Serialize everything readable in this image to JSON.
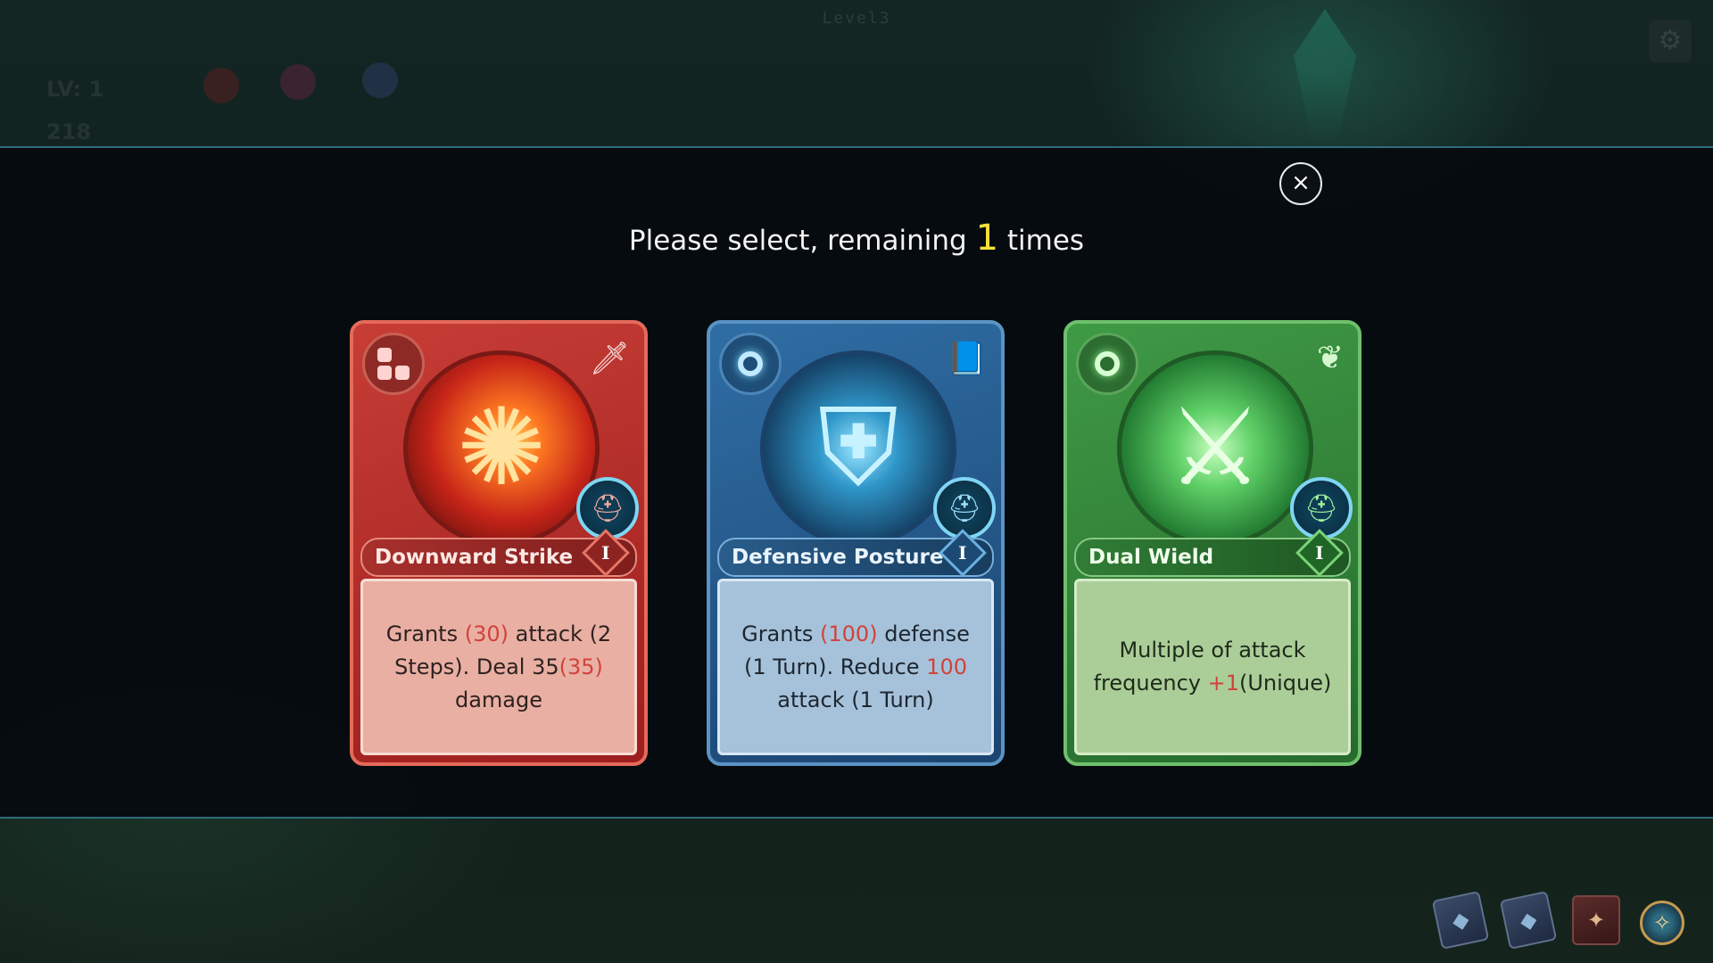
{
  "background": {
    "level_label": "Level3",
    "hud": {
      "level_text": "LV: 1",
      "hp_value": "218"
    }
  },
  "modal": {
    "close_icon": "×",
    "prompt_prefix": "Please select, remaining",
    "remaining_count": "1",
    "prompt_suffix": "times"
  },
  "cards": [
    {
      "name": "Downward Strike",
      "rank": "I",
      "theme": "red",
      "type_icon": "sword-icon",
      "badge_icon": "dots-icon",
      "art_icon": "slash-art",
      "desc_parts": [
        "Grants ",
        "(30)",
        " attack (2 Steps). Deal 35",
        "(35)",
        " damage"
      ]
    },
    {
      "name": "Defensive Posture",
      "rank": "I",
      "theme": "blue",
      "type_icon": "book-icon",
      "badge_icon": "ring-icon",
      "art_icon": "shield-art",
      "desc_parts": [
        "Grants ",
        "(100)",
        " defense  (1 Turn). Reduce ",
        "100",
        " attack (1 Turn)"
      ]
    },
    {
      "name": "Dual Wield",
      "rank": "I",
      "theme": "green",
      "type_icon": "leaf-icon",
      "badge_icon": "ring-icon",
      "art_icon": "crossed-swords-art",
      "desc_parts": [
        "Multiple of attack frequency ",
        "+1",
        "(Unique)"
      ]
    }
  ],
  "tray": {
    "buttons": [
      "deck-icon",
      "deck-icon",
      "spellbook-icon",
      "compass-icon"
    ]
  },
  "colors": {
    "highlight": "#d0433a",
    "count": "#f4e23a",
    "red_card": "#c73d36",
    "blue_card": "#2f6ea5",
    "green_card": "#3f9a45"
  }
}
